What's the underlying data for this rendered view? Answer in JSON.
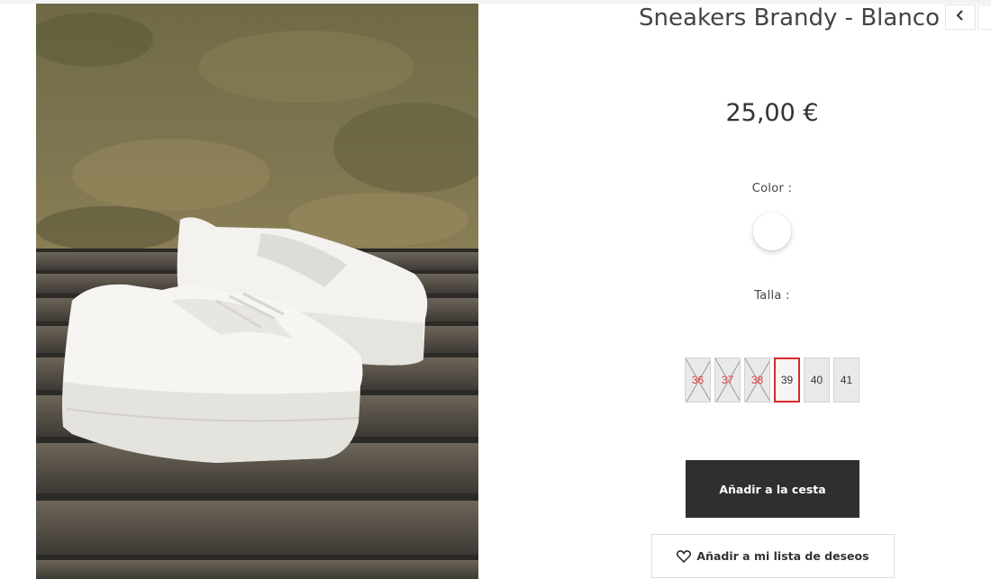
{
  "product": {
    "title": "Sneakers Brandy - Blanco",
    "price": "25,00 €",
    "color_label": "Color :",
    "color_swatch": "#ffffff",
    "size_label": "Talla :",
    "sizes": [
      {
        "label": "36",
        "available": false
      },
      {
        "label": "37",
        "available": false
      },
      {
        "label": "38",
        "available": false
      },
      {
        "label": "39",
        "available": true,
        "selected": true
      },
      {
        "label": "40",
        "available": true
      },
      {
        "label": "41",
        "available": true
      }
    ],
    "add_to_cart": "Añadir a la cesta",
    "wishlist": "Añadir a mi lista de deseos"
  },
  "nav": {
    "prev_icon": "chevron-left-icon",
    "next_icon": "chevron-right-icon"
  },
  "colors": {
    "button_dark": "#2f2f2f",
    "selected_border": "#d62b2b",
    "unavailable_text": "#e23b3b"
  }
}
